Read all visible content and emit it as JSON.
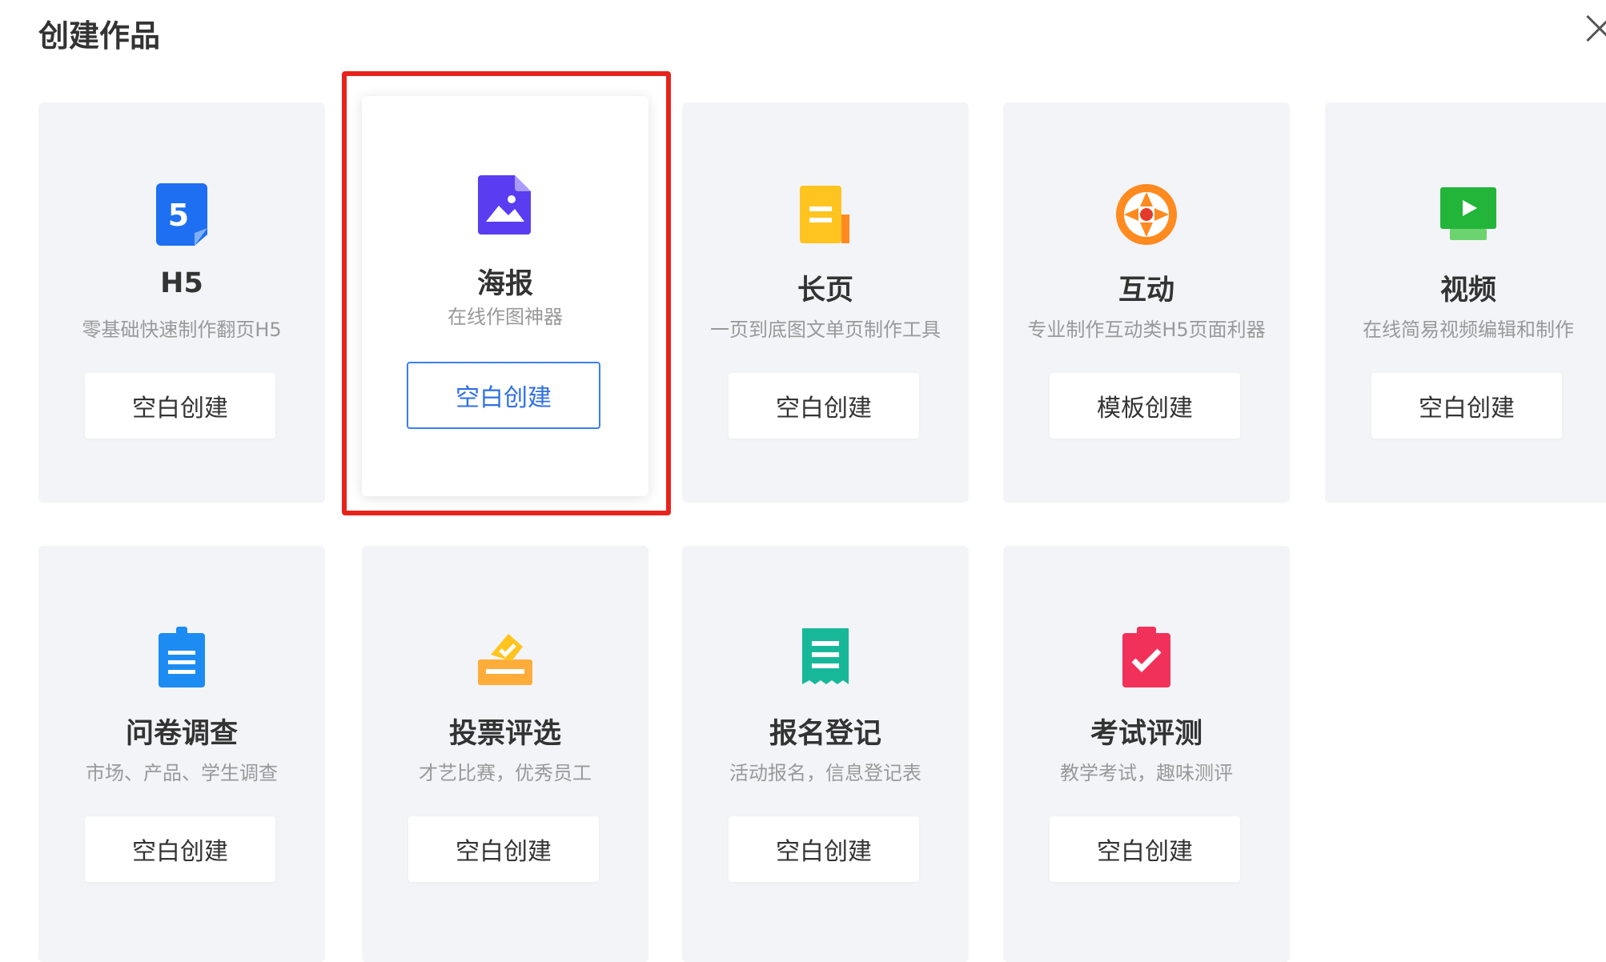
{
  "dialog": {
    "title": "创建作品"
  },
  "cards": [
    {
      "title": "H5",
      "desc": "零基础快速制作翻页H5",
      "button": "空白创建",
      "icon": "h5-icon"
    },
    {
      "title": "海报",
      "desc": "在线作图神器",
      "button": "空白创建",
      "icon": "poster-icon"
    },
    {
      "title": "长页",
      "desc": "一页到底图文单页制作工具",
      "button": "空白创建",
      "icon": "long-page-icon"
    },
    {
      "title": "互动",
      "desc": "专业制作互动类H5页面利器",
      "button": "模板创建",
      "icon": "interactive-icon"
    },
    {
      "title": "视频",
      "desc": "在线简易视频编辑和制作",
      "button": "空白创建",
      "icon": "video-icon"
    },
    {
      "title": "问卷调查",
      "desc": "市场、产品、学生调查",
      "button": "空白创建",
      "icon": "survey-icon"
    },
    {
      "title": "投票评选",
      "desc": "才艺比赛，优秀员工",
      "button": "空白创建",
      "icon": "vote-icon"
    },
    {
      "title": "报名登记",
      "desc": "活动报名，信息登记表",
      "button": "空白创建",
      "icon": "registration-icon"
    },
    {
      "title": "考试评测",
      "desc": "教学考试，趣味测评",
      "button": "空白创建",
      "icon": "exam-icon"
    }
  ],
  "colors": {
    "highlight": "#e8231c",
    "card_bg": "#f2f4f7",
    "selected_button": "#3a7ff5"
  }
}
